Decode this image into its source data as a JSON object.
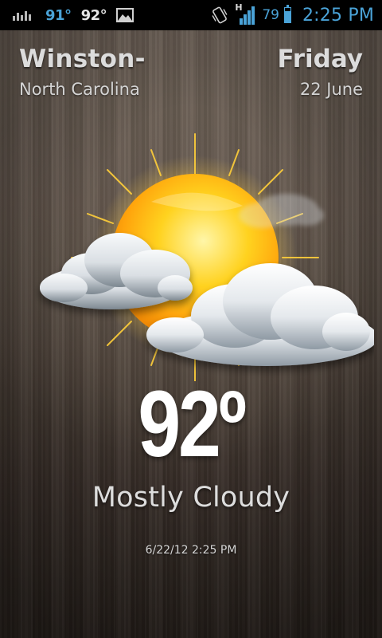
{
  "status_bar": {
    "notif_temp_blue": "91°",
    "notif_temp_white": "92°",
    "battery_percent": "79",
    "battery_level": 0.79,
    "network_type": "H",
    "time": "2:25 PM",
    "icons": [
      "chart-icon",
      "image-icon",
      "vibrate-icon",
      "signal-icon",
      "battery-icon"
    ],
    "accent_color": "#4aa3d8"
  },
  "location": {
    "city": "Winston-",
    "state": "North Carolina"
  },
  "date": {
    "day": "Friday",
    "date": "22 June"
  },
  "weather": {
    "temperature": "92º",
    "condition": "Mostly Cloudy",
    "updated": "6/22/12 2:25 PM",
    "icon": "partly-cloudy-sun-icon"
  }
}
